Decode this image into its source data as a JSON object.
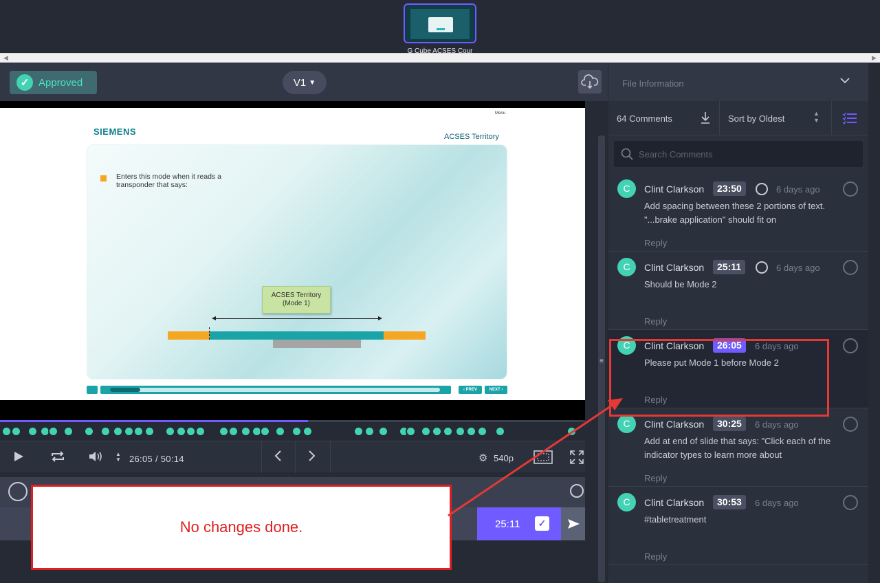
{
  "top": {
    "thumbnail_label": "G Cube ACSES Cour"
  },
  "header": {
    "status_label": "Approved",
    "version_label": "V1"
  },
  "slide": {
    "menu": "Menu",
    "logo": "SIEMENS",
    "title": "ACSES Territory",
    "bullet_text": "Enters this mode when it reads a transponder that says:",
    "tag_line1": "ACSES Territory",
    "tag_line2": "(Mode 1)",
    "prev": "‹ PREV",
    "next": "NEXT ›"
  },
  "player": {
    "current_time": "26:05",
    "duration": "50:14",
    "time_display": "26:05 / 50:14",
    "resolution": "540p",
    "progress": 0.527
  },
  "comment_input": {
    "timecode": "25:11"
  },
  "right_panel": {
    "file_info_label": "File Information",
    "comment_count": "64 Comments",
    "sort_label": "Sort by Oldest",
    "search_placeholder": "Search Comments",
    "comments": [
      {
        "avatar": "C",
        "name": "Clint Clarkson",
        "timecode": "23:50",
        "has_drawing": true,
        "ago": "6 days ago",
        "body": "Add spacing between these 2 portions of text. \"...brake application\" should fit on",
        "reply": "Reply"
      },
      {
        "avatar": "C",
        "name": "Clint Clarkson",
        "timecode": "25:11",
        "has_drawing": true,
        "ago": "6 days ago",
        "body": "Should be Mode 2",
        "reply": "Reply"
      },
      {
        "avatar": "C",
        "name": "Clint Clarkson",
        "timecode": "26:05",
        "has_drawing": false,
        "ago": "6 days ago",
        "body": "Please put Mode 1 before Mode 2",
        "reply": "Reply",
        "active": true
      },
      {
        "avatar": "C",
        "name": "Clint Clarkson",
        "timecode": "30:25",
        "has_drawing": false,
        "ago": "6 days ago",
        "body": "Add at end of slide that says: \"Click each of the indicator types to learn more about",
        "reply": "Reply"
      },
      {
        "avatar": "C",
        "name": "Clint Clarkson",
        "timecode": "30:53",
        "has_drawing": false,
        "ago": "6 days ago",
        "body": "#tabletreatment",
        "reply": "Reply"
      }
    ]
  },
  "annotation": {
    "note_text": "No changes done."
  },
  "colors": {
    "accent": "#6f5bff",
    "approved": "#43d3b4",
    "annotation_red": "#e02020"
  }
}
